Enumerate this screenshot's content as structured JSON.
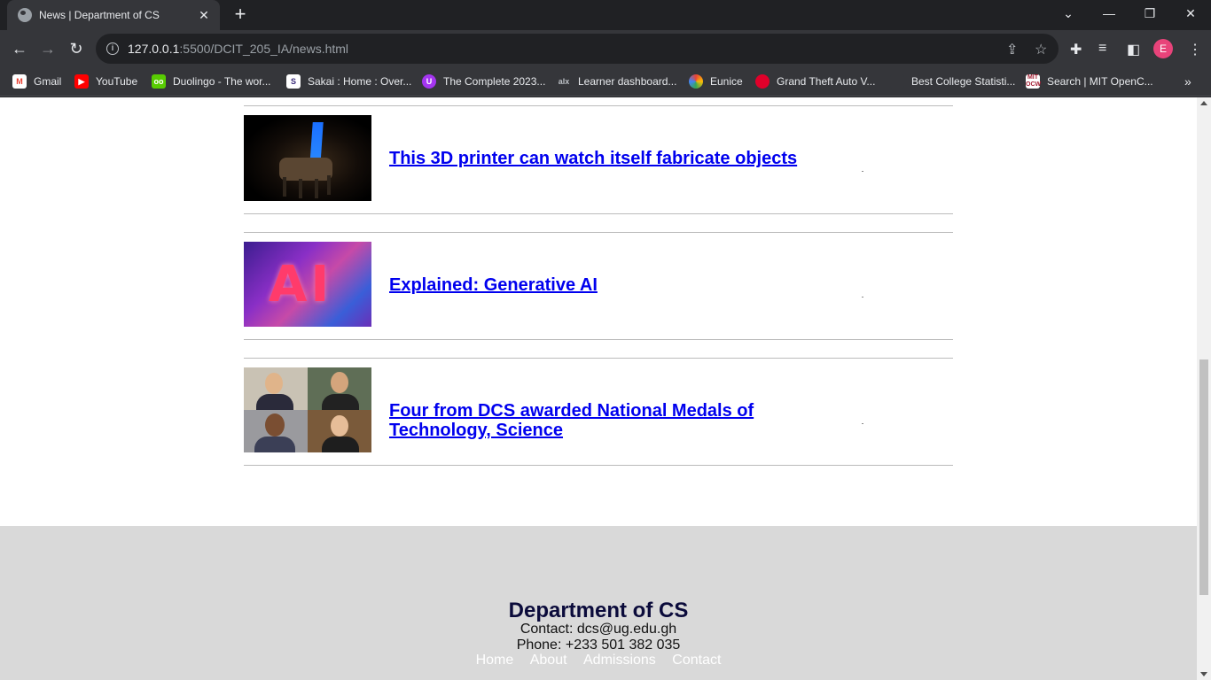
{
  "browser": {
    "tab_title": "News | Department of CS",
    "url_host": "127.0.0.1",
    "url_path": ":5500/DCIT_205_IA/news.html",
    "profile_initial": "E",
    "bookmarks": [
      {
        "label": "Gmail",
        "icon": "gmail-icon",
        "color": "#ea4335"
      },
      {
        "label": "YouTube",
        "icon": "youtube-icon",
        "color": "#ff0000"
      },
      {
        "label": "Duolingo - The wor...",
        "icon": "duolingo-icon",
        "color": "#58cc02"
      },
      {
        "label": "Sakai : Home : Over...",
        "icon": "sakai-icon",
        "color": "#ffffff"
      },
      {
        "label": "The Complete 2023...",
        "icon": "udemy-icon",
        "color": "#a435f0"
      },
      {
        "label": "Learner dashboard...",
        "icon": "alx-icon",
        "color": "#202124"
      },
      {
        "label": "Eunice",
        "icon": "eunice-icon",
        "color": "#4285f4"
      },
      {
        "label": "Grand Theft Auto V...",
        "icon": "gta-icon",
        "color": "#e0002a"
      },
      {
        "label": "Best College Statisti...",
        "icon": "bookmark-icon",
        "color": "#35363a"
      },
      {
        "label": "Search | MIT OpenC...",
        "icon": "mit-ocw-icon",
        "color": "#a31f34"
      }
    ]
  },
  "news": [
    {
      "title": "This 3D printer can watch itself fabricate objects",
      "thumb": "3d-printer-thumbnail"
    },
    {
      "title": "Explained: Generative AI",
      "thumb": "generative-ai-thumbnail"
    },
    {
      "title": "Four from DCS awarded National Medals of Technology, Science",
      "thumb": "medal-winners-thumbnail"
    }
  ],
  "footer": {
    "title": "Department of CS",
    "contact": "Contact: dcs@ug.edu.gh",
    "phone": "Phone: +233 501 382 035",
    "links": [
      "Home",
      "About",
      "Admissions",
      "Contact"
    ]
  },
  "colors": {
    "link": "#0000ee",
    "footer_bg": "#d9d9d9",
    "footer_title": "#0b0b3b"
  }
}
